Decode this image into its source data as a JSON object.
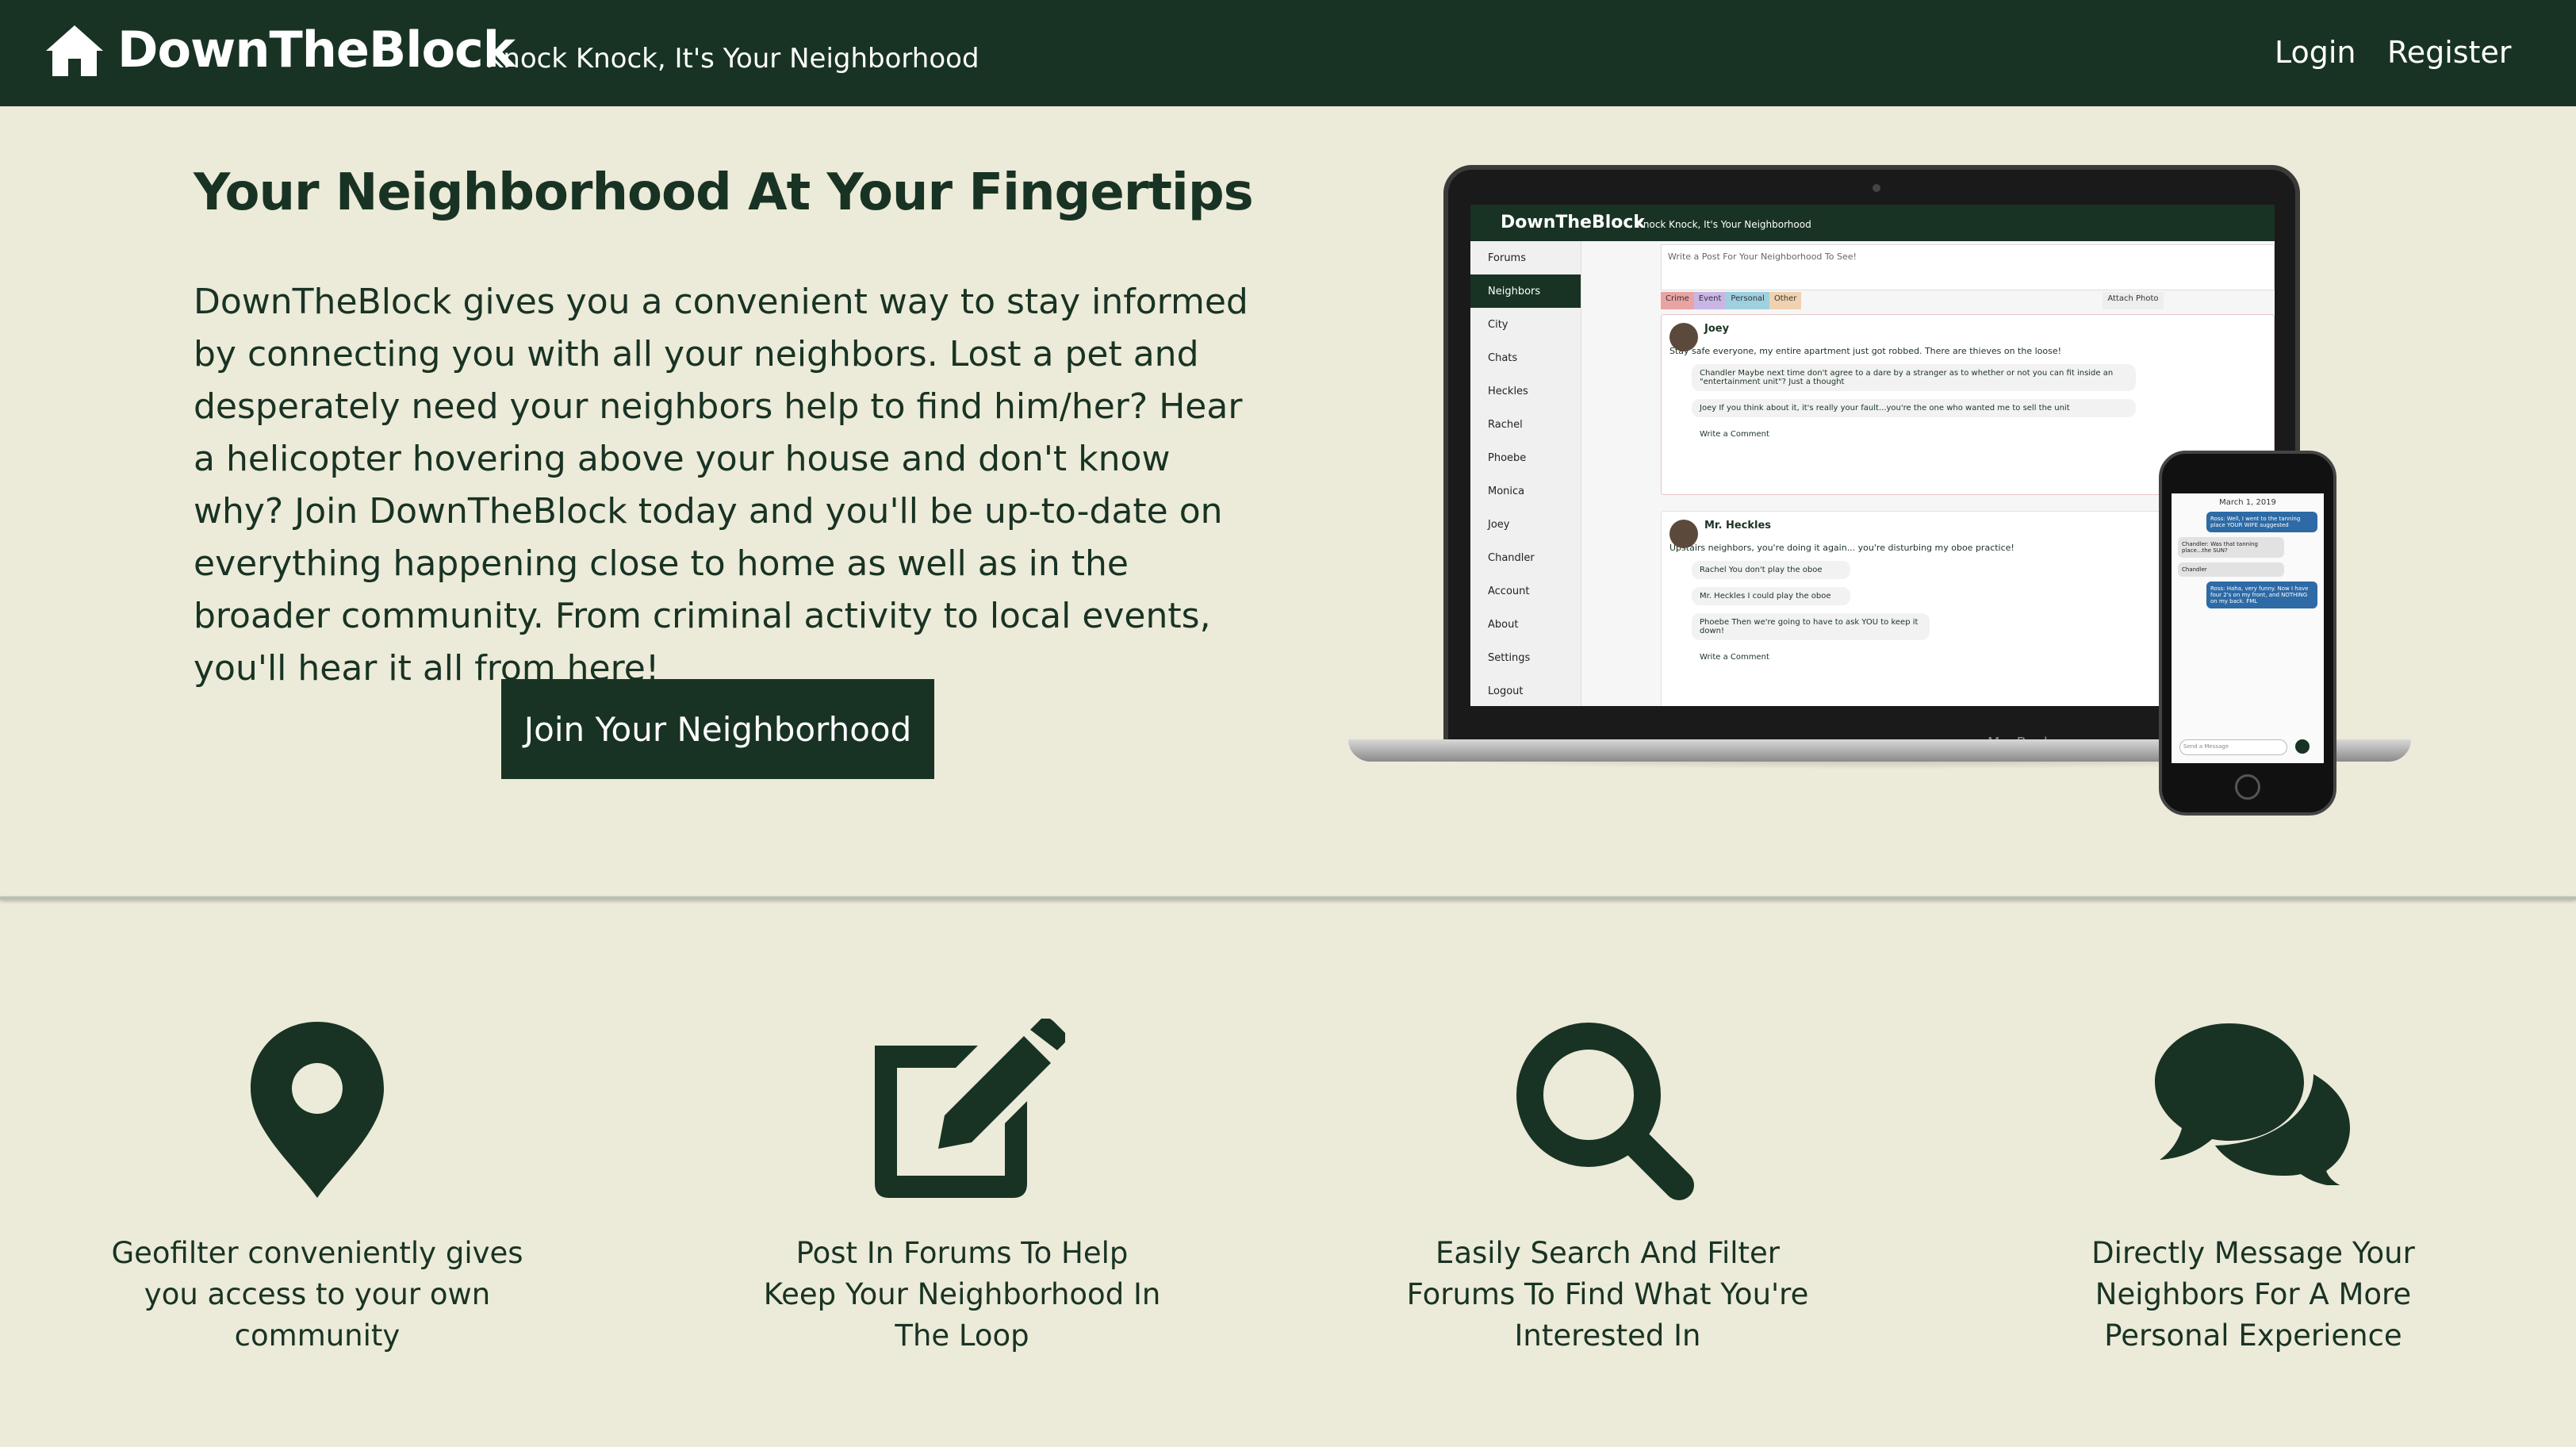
{
  "navbar": {
    "brand_name": "DownTheBlock",
    "tagline": "Knock Knock, It's Your Neighborhood",
    "home_icon": "home-icon",
    "login_label": "Login",
    "register_label": "Register",
    "bg_color": "#183324"
  },
  "hero": {
    "title": "Your Neighborhood At Your Fingertips",
    "description": "DownTheBlock gives you a convenient way to stay informed by connecting you with all your neighbors. Lost a pet and desperately need your neighbors help to find him/her? Hear a helicopter hovering above your house and don't know why? Join DownTheBlock today and you'll be up-to-date on everything happening close to home as well as in the broader community. From criminal activity to local events, you'll hear it all from here!",
    "cta_label": "Join Your Neighborhood"
  },
  "mockup": {
    "laptop_brand": "MacBook",
    "screen": {
      "brand_name": "DownTheBlock",
      "tagline": "Knock Knock, It's Your Neighborhood",
      "sidebar": [
        "Forums",
        "Neighbors",
        "City",
        "Chats",
        "Heckles",
        "Rachel",
        "Phoebe",
        "Monica",
        "Joey",
        "Chandler",
        "Account",
        "About",
        "Settings",
        "Logout"
      ],
      "post_placeholder": "Write a Post For Your Neighborhood To See!",
      "tags": [
        "Crime",
        "Event",
        "Personal",
        "Other"
      ],
      "attach_label": "Attach Photo",
      "posts": [
        {
          "author": "Joey",
          "body": "Stay safe everyone, my entire apartment just got robbed. There are thieves on the loose!",
          "comments": [
            "Chandler Maybe next time don't agree to a dare by a stranger as to whether or not you can fit inside an \"entertainment unit\"? Just a thought",
            "Joey If you think about it, it's really your fault...you're the one who wanted me to sell the unit"
          ],
          "comment_placeholder": "Write a Comment"
        },
        {
          "author": "Mr. Heckles",
          "body": "Upstairs neighbors, you're doing it again... you're disturbing my oboe practice!",
          "comments": [
            "Rachel You don't play the oboe",
            "Mr. Heckles I could play the oboe",
            "Phoebe Then we're going to have to ask YOU to keep it down!"
          ],
          "comment_placeholder": "Write a Comment"
        }
      ]
    },
    "phone": {
      "date": "March 1, 2019",
      "messages": [
        {
          "from": "me",
          "text": "Ross: Well, I went to the tanning place YOUR WIFE suggested"
        },
        {
          "from": "them",
          "text": "Chandler: Was that tanning place...the SUN?"
        },
        {
          "from": "them",
          "text": "Chandler"
        },
        {
          "from": "me",
          "text": "Ross: Haha, very funny. Now I have four 2's on my front, and NOTHING on my back. FML"
        }
      ],
      "input_placeholder": "Send a Message"
    }
  },
  "features": [
    {
      "icon": "map-pin-icon",
      "text": "Geofilter conveniently gives you access to your own community"
    },
    {
      "icon": "edit-icon",
      "text": "Post In Forums To Help Keep Your Neighborhood In The Loop"
    },
    {
      "icon": "search-icon",
      "text": "Easily Search And Filter Forums To Find What You're Interested In"
    },
    {
      "icon": "chat-bubbles-icon",
      "text": "Directly Message Your Neighbors For A More Personal Experience"
    }
  ],
  "colors": {
    "background": "#ecead8",
    "primary": "#183324"
  }
}
